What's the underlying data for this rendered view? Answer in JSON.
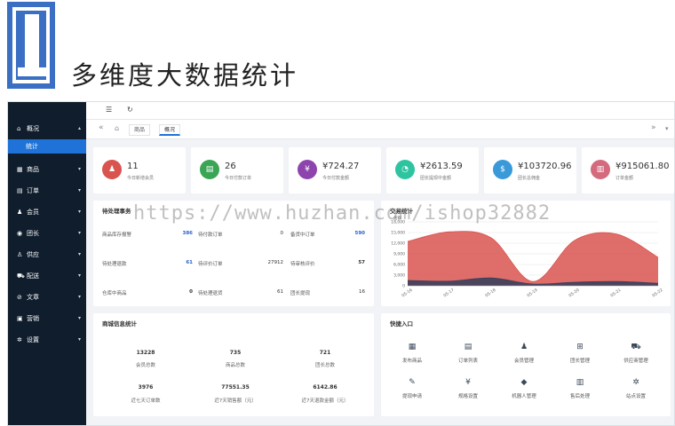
{
  "banner": {
    "title": "多维度大数据统计"
  },
  "sidebar": {
    "items": [
      {
        "label": "概况",
        "icon": "home-icon",
        "glyph": "⌂",
        "caret": "▴"
      },
      {
        "label": "商品",
        "icon": "box-icon",
        "glyph": "▦",
        "caret": "▾"
      },
      {
        "label": "订单",
        "icon": "document-icon",
        "glyph": "▤",
        "caret": "▾"
      },
      {
        "label": "会员",
        "icon": "users-icon",
        "glyph": "♟",
        "caret": "▾"
      },
      {
        "label": "团长",
        "icon": "eye-icon",
        "glyph": "◉",
        "caret": "▾"
      },
      {
        "label": "供应",
        "icon": "supplier-icon",
        "glyph": "♙",
        "caret": "▾"
      },
      {
        "label": "配送",
        "icon": "truck-icon",
        "glyph": "⛟",
        "caret": "▾"
      },
      {
        "label": "文章",
        "icon": "article-icon",
        "glyph": "⊘",
        "caret": "▾"
      },
      {
        "label": "营销",
        "icon": "marketing-icon",
        "glyph": "▣",
        "caret": "▾"
      },
      {
        "label": "设置",
        "icon": "gear-icon",
        "glyph": "✲",
        "caret": "▾"
      }
    ],
    "sub_active": "统计"
  },
  "topbar": {
    "menu_glyph": "☰",
    "refresh_glyph": "↻"
  },
  "tabs": {
    "left_arrow": "«",
    "home_glyph": "⌂",
    "items": [
      {
        "label": "商品"
      },
      {
        "label": "概况"
      }
    ],
    "right_arrow": "»",
    "more": "▾"
  },
  "stats": [
    {
      "value": "11",
      "label": "今日新增会员",
      "color": "#d9534f",
      "icon": "user-add-icon",
      "glyph": "♟"
    },
    {
      "value": "26",
      "label": "今日付款订单",
      "color": "#3aa655",
      "icon": "order-icon",
      "glyph": "▤"
    },
    {
      "value": "¥724.27",
      "label": "今日付款金额",
      "color": "#8e44ad",
      "icon": "yen-icon",
      "glyph": "¥"
    },
    {
      "value": "¥2613.59",
      "label": "团长提现中金额",
      "color": "#2ec4a0",
      "icon": "pie-icon",
      "glyph": "◔"
    },
    {
      "value": "¥103720.96",
      "label": "团长总佣金",
      "color": "#3a9ad9",
      "icon": "moneybag-icon",
      "glyph": "$"
    },
    {
      "value": "¥915061.80",
      "label": "订单金额",
      "color": "#d46a7e",
      "icon": "receipt-icon",
      "glyph": "▥"
    }
  ],
  "todo": {
    "title": "待处理事务",
    "items": [
      {
        "label": "商品库存报警",
        "value": "386",
        "style": "blue"
      },
      {
        "label": "待付款订单",
        "value": "0",
        "style": ""
      },
      {
        "label": "备货中订单",
        "value": "590",
        "style": "blue"
      },
      {
        "label": "待处理退款",
        "value": "61",
        "style": "blue"
      },
      {
        "label": "待评价订单",
        "value": "27912",
        "style": ""
      },
      {
        "label": "待审核评价",
        "value": "57",
        "style": "bold"
      },
      {
        "label": "仓库中商品",
        "value": "0",
        "style": "bold"
      },
      {
        "label": "待处理退货",
        "value": "61",
        "style": ""
      },
      {
        "label": "团长提现",
        "value": "16",
        "style": ""
      }
    ]
  },
  "trade_chart": {
    "title": "交易统计",
    "unit": "金额"
  },
  "chart_data": {
    "type": "area",
    "title": "交易统计",
    "ylabel": "金额",
    "y_ticks": [
      "18,000",
      "15,000",
      "12,000",
      "9,000",
      "6,000",
      "3,000",
      "0"
    ],
    "ylim": [
      0,
      18000
    ],
    "categories": [
      "05-16",
      "05-17",
      "05-18",
      "05-19",
      "05-20",
      "05-21",
      "05-22"
    ],
    "x_labels": [
      "05-16",
      "05-17",
      "05-18",
      "05-19",
      "05-20",
      "05-21",
      "05-22"
    ],
    "series": [
      {
        "name": "",
        "color": "#d9534f",
        "values": [
          12500,
          15200,
          13500,
          1200,
          12800,
          14600,
          8000
        ]
      },
      {
        "name": "",
        "color": "#3b3f5c",
        "values": [
          1500,
          1300,
          2200,
          500,
          1000,
          1200,
          700
        ]
      }
    ],
    "grid": true
  },
  "mall_info": {
    "title": "商城信息统计",
    "items": [
      {
        "value": "13228",
        "label": "会员总数"
      },
      {
        "value": "735",
        "label": "商品总数"
      },
      {
        "value": "721",
        "label": "团长总数"
      },
      {
        "value": "3976",
        "label": "近七天订单数"
      },
      {
        "value": "77551.35",
        "label": "近7天销售额（元）"
      },
      {
        "value": "6142.86",
        "label": "近7天退款金额（元）"
      }
    ]
  },
  "quick": {
    "title": "快捷入口",
    "items": [
      {
        "label": "发布商品",
        "icon": "product-icon",
        "glyph": "▦"
      },
      {
        "label": "订单列表",
        "icon": "clipboard-icon",
        "glyph": "▤"
      },
      {
        "label": "会员管理",
        "icon": "member-icon",
        "glyph": "♟"
      },
      {
        "label": "团长管理",
        "icon": "org-icon",
        "glyph": "⊞"
      },
      {
        "label": "供应商管理",
        "icon": "truck-icon",
        "glyph": "⛟"
      },
      {
        "label": "提现申请",
        "icon": "ticket-icon",
        "glyph": "✎"
      },
      {
        "label": "规格设置",
        "icon": "yen-circle-icon",
        "glyph": "¥"
      },
      {
        "label": "机器人管理",
        "icon": "tag-icon",
        "glyph": "◆"
      },
      {
        "label": "售后处理",
        "icon": "aftersale-icon",
        "glyph": "▥"
      },
      {
        "label": "站点设置",
        "icon": "settings-icon",
        "glyph": "✲"
      }
    ]
  },
  "watermark": "https://www.huzhan.com/ishop32882"
}
